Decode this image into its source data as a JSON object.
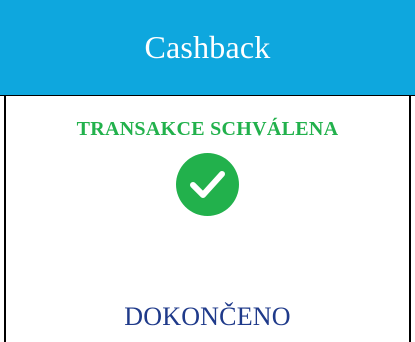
{
  "header": {
    "title": "Cashback",
    "background_color": "#0ea7de"
  },
  "main": {
    "status_text": "TRANSAKCE SCHVÁLENA",
    "status_color": "#22b14c",
    "status_icon": "check-circle-icon",
    "done_text": "DOKONČENO",
    "done_color": "#1f3a8a"
  }
}
